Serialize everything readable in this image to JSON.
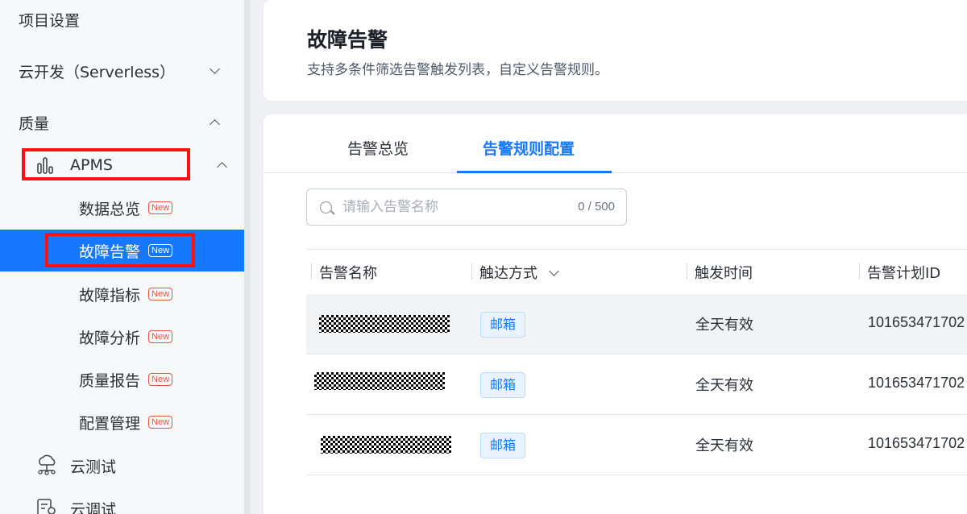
{
  "sidebar": {
    "project_settings": "项目设置",
    "cloud_dev": "云开发（Serverless）",
    "quality": "质量",
    "apms": "APMS",
    "sub_items": [
      {
        "label": "数据总览",
        "badge": "New"
      },
      {
        "label": "故障告警",
        "badge": "New"
      },
      {
        "label": "故障指标",
        "badge": "New"
      },
      {
        "label": "故障分析",
        "badge": "New"
      },
      {
        "label": "质量报告",
        "badge": "New"
      },
      {
        "label": "配置管理",
        "badge": "New"
      }
    ],
    "cloud_test": "云测试",
    "cloud_debug": "云调试"
  },
  "header": {
    "title": "故障告警",
    "description": "支持多条件筛选告警触发列表，自定义告警规则。"
  },
  "tabs": [
    {
      "label": "告警总览",
      "active": false
    },
    {
      "label": "告警规则配置",
      "active": true
    }
  ],
  "search": {
    "placeholder": "请输入告警名称",
    "value": "",
    "count": "0 / 500"
  },
  "table": {
    "columns": [
      "告警名称",
      "触达方式",
      "触发时间",
      "告警计划ID"
    ],
    "rows": [
      {
        "channel": "邮箱",
        "time": "全天有效",
        "plan_id": "101653471702"
      },
      {
        "channel": "邮箱",
        "time": "全天有效",
        "plan_id": "101653471702"
      },
      {
        "channel": "邮箱",
        "time": "全天有效",
        "plan_id": "101653471702"
      }
    ]
  },
  "colors": {
    "accent": "#1677ff",
    "highlight_box": "#ff1010",
    "new_badge": "#e8523f"
  }
}
